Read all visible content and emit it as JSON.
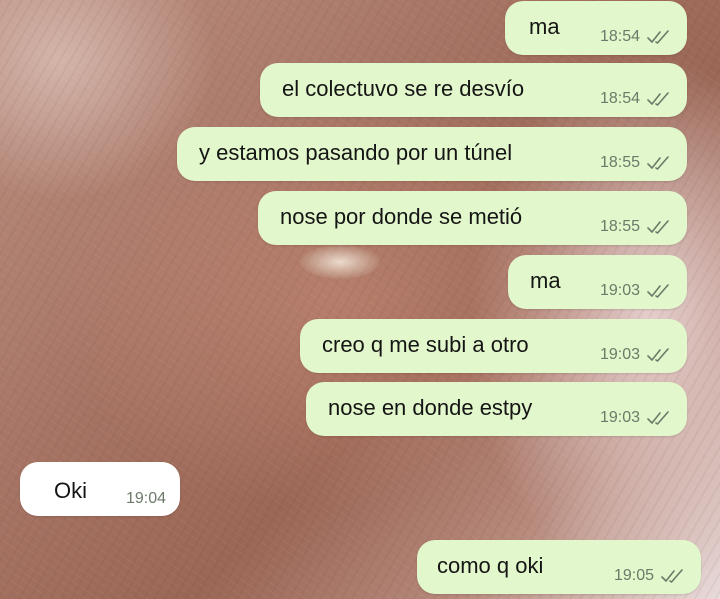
{
  "chat": {
    "messages": [
      {
        "text": "ma",
        "time": "18:54",
        "direction": "out",
        "status_icon": "double-check-icon"
      },
      {
        "text": "el colectuvo se re desvío",
        "time": "18:54",
        "direction": "out",
        "status_icon": "double-check-icon"
      },
      {
        "text": "y estamos pasando por un túnel",
        "time": "18:55",
        "direction": "out",
        "status_icon": "double-check-icon"
      },
      {
        "text": "nose por donde se metió",
        "time": "18:55",
        "direction": "out",
        "status_icon": "double-check-icon"
      },
      {
        "text": "ma",
        "time": "19:03",
        "direction": "out",
        "status_icon": "double-check-icon"
      },
      {
        "text": "creo q me subi a otro",
        "time": "19:03",
        "direction": "out",
        "status_icon": "double-check-icon"
      },
      {
        "text": "nose en donde estpy",
        "time": "19:03",
        "direction": "out",
        "status_icon": "double-check-icon"
      },
      {
        "text": "Oki",
        "time": "19:04",
        "direction": "in"
      },
      {
        "text": "como q oki",
        "time": "19:05",
        "direction": "out",
        "status_icon": "double-check-icon"
      }
    ]
  },
  "colors": {
    "outgoing_bubble": "#e2f7cb",
    "incoming_bubble": "#ffffff",
    "time_text": "#6d7a6a",
    "tick_color": "#6d7a6a"
  }
}
